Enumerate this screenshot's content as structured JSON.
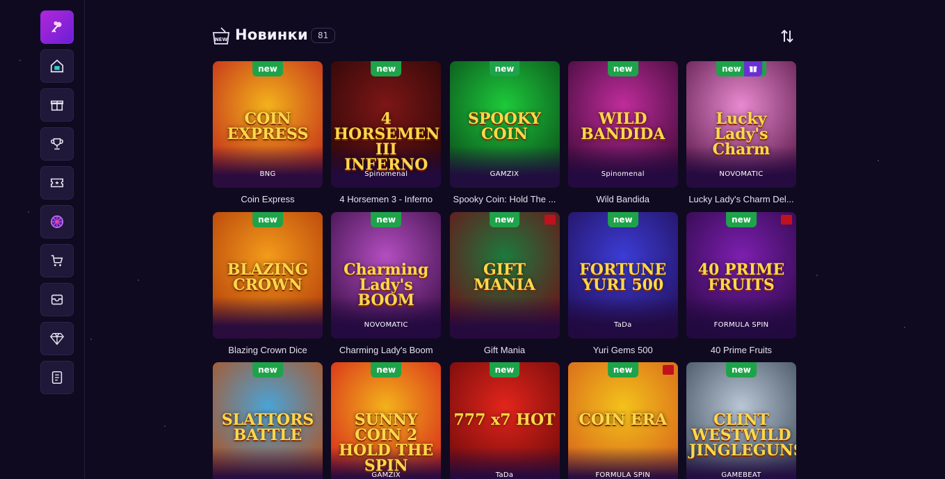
{
  "header": {
    "title": "Новинки",
    "count": "81",
    "new_icon_label": "NEW"
  },
  "sidebar": {
    "items": [
      {
        "icon": "clover-key-icon"
      },
      {
        "icon": "home-icon"
      },
      {
        "icon": "gift-icon"
      },
      {
        "icon": "trophy-icon"
      },
      {
        "icon": "ticket-icon"
      },
      {
        "icon": "wheel-icon"
      },
      {
        "icon": "shop-cart-icon"
      },
      {
        "icon": "box-icon"
      },
      {
        "icon": "diamond-icon"
      },
      {
        "icon": "document-icon"
      }
    ]
  },
  "badge_label": "new",
  "games": [
    {
      "name": "Coin Express",
      "logo": "COIN EXPRESS",
      "provider": "BNG",
      "bg": [
        "#f3b21b",
        "#c0261b"
      ]
    },
    {
      "name": "4 Horsemen 3 - Inferno",
      "logo": "4 HORSEMEN III INFERNO",
      "provider": "Spinomenal",
      "bg": [
        "#7d1616",
        "#2a0707"
      ]
    },
    {
      "name": "Spooky Coin: Hold The ...",
      "logo": "SPOOKY COIN",
      "provider": "GAMZIX",
      "bg": [
        "#1dc93b",
        "#0b4d1a"
      ]
    },
    {
      "name": "Wild Bandida",
      "logo": "WILD BANDIDA",
      "provider": "Spinomenal",
      "bg": [
        "#c02c9c",
        "#3c0a35"
      ]
    },
    {
      "name": "Lucky Lady's Charm Del...",
      "logo": "Lucky Lady's Charm",
      "provider": "NOVOMATIC",
      "bg": [
        "#e88ad0",
        "#5a1848"
      ]
    },
    {
      "name": "Blazing Crown Dice",
      "logo": "BLAZING CROWN",
      "provider": "",
      "bg": [
        "#f39b1b",
        "#b33d0a"
      ]
    },
    {
      "name": "Charming Lady's Boom",
      "logo": "Charming Lady's BOOM",
      "provider": "NOVOMATIC",
      "bg": [
        "#b34ec0",
        "#3b0f46"
      ]
    },
    {
      "name": "Gift Mania",
      "logo": "GIFT MANIA",
      "provider": "",
      "bg": [
        "#1c7a3d",
        "#6e0f18"
      ]
    },
    {
      "name": "Yuri Gems 500",
      "logo": "FORTUNE YURI 500",
      "provider": "TaDa",
      "bg": [
        "#3c3cd6",
        "#22105a"
      ]
    },
    {
      "name": "40 Prime Fruits",
      "logo": "40 PRIME FRUITS",
      "provider": "FORMULA SPIN",
      "bg": [
        "#7d1fb0",
        "#2c0946"
      ]
    },
    {
      "name": "",
      "logo": "SLATTORS BATTLE",
      "provider": "",
      "bg": [
        "#4aa3d6",
        "#b3501b"
      ]
    },
    {
      "name": "",
      "logo": "SUNNY COIN 2 HOLD THE SPIN",
      "provider": "GAMZIX",
      "bg": [
        "#f3b21b",
        "#d6231b"
      ]
    },
    {
      "name": "",
      "logo": "777 x7 HOT",
      "provider": "TaDa",
      "bg": [
        "#e2251b",
        "#6e0a0a"
      ]
    },
    {
      "name": "",
      "logo": "COIN ERA",
      "provider": "FORMULA SPIN",
      "bg": [
        "#f3c21b",
        "#d6601b"
      ]
    },
    {
      "name": "",
      "logo": "CLINT WESTWILD JINGLEGUNS",
      "provider": "GAMEBEAT",
      "bg": [
        "#b9c6d6",
        "#3c4a5a"
      ]
    }
  ]
}
